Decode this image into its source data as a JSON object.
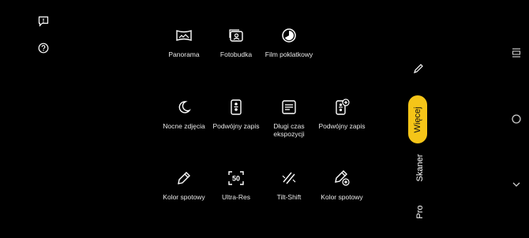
{
  "left_bar": {
    "feedback_icon": "feedback-icon",
    "help_icon": "help-icon"
  },
  "modes": [
    {
      "id": "panorama",
      "label": "Panorama",
      "icon": "panorama-icon"
    },
    {
      "id": "fotobudka",
      "label": "Fotobudka",
      "icon": "photobooth-icon"
    },
    {
      "id": "film-poklatkowy",
      "label": "Film poklatkowy",
      "icon": "timelapse-icon"
    },
    {
      "id": "nocne-zdjecia",
      "label": "Nocne zdjęcia",
      "icon": "moon-icon"
    },
    {
      "id": "podwojny-zapis-1",
      "label": "Podwójny zapis",
      "icon": "dual-record-icon"
    },
    {
      "id": "dlugi-czas",
      "label": "Długi czas\nekspozycji",
      "icon": "long-exposure-icon"
    },
    {
      "id": "podwojny-zapis-2",
      "label": "Podwójny zapis",
      "icon": "dual-record-add-icon"
    },
    {
      "id": "kolor-spotowy-1",
      "label": "Kolor spotowy",
      "icon": "color-picker-icon"
    },
    {
      "id": "ultra-res",
      "label": "Ultra-Res",
      "icon": "ultra-res-icon"
    },
    {
      "id": "tilt-shift",
      "label": "Tilt-Shift",
      "icon": "tilt-shift-icon"
    },
    {
      "id": "kolor-spotowy-2",
      "label": "Kolor spotowy",
      "icon": "color-picker-add-icon"
    }
  ],
  "mode_carousel": {
    "selected": "Więcej",
    "items": [
      "Skaner",
      "Pro"
    ]
  },
  "ultra_res_badge": "50",
  "accent_color": "#f5c518"
}
